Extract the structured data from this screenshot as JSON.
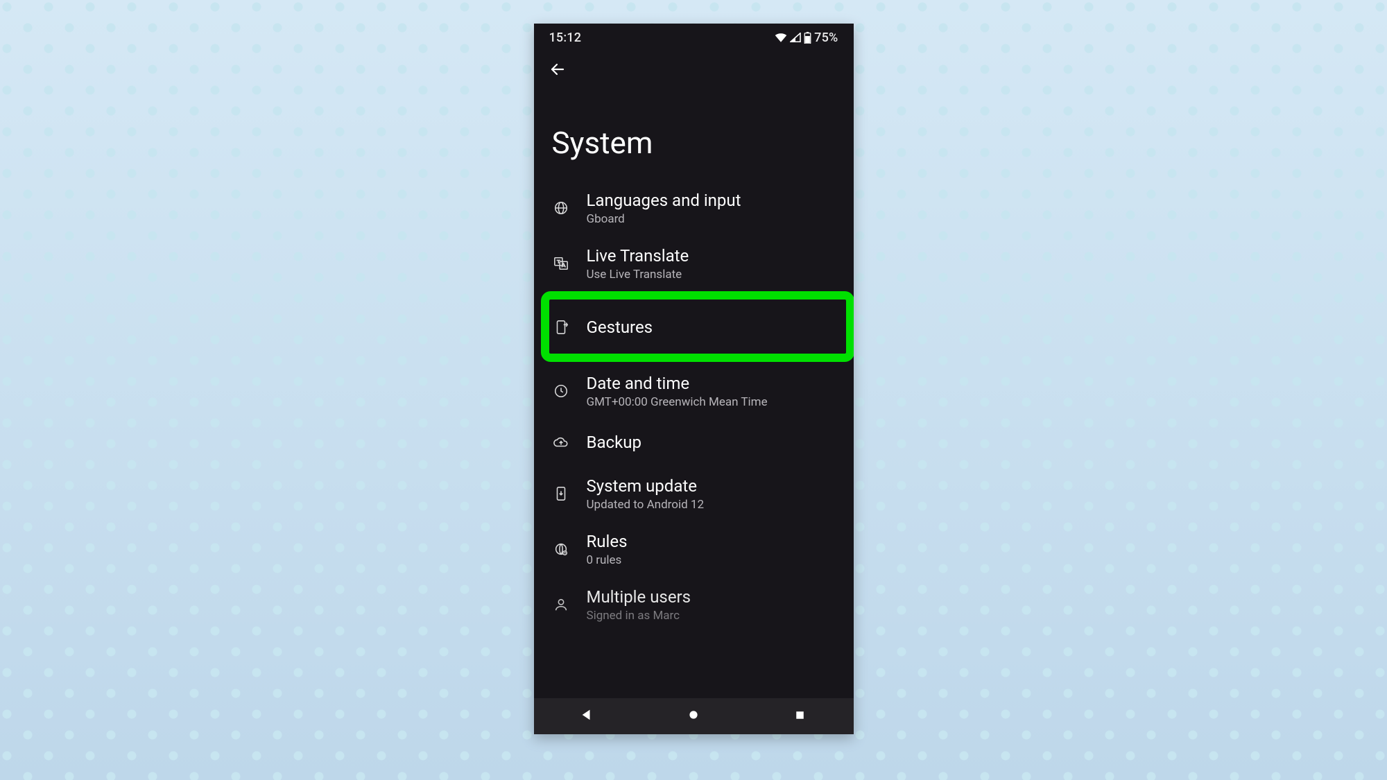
{
  "status": {
    "time": "15:12",
    "battery": "75%"
  },
  "page": {
    "title": "System"
  },
  "rows": {
    "languages": {
      "title": "Languages and input",
      "subtitle": "Gboard"
    },
    "translate": {
      "title": "Live Translate",
      "subtitle": "Use Live Translate"
    },
    "gestures": {
      "title": "Gestures"
    },
    "datetime": {
      "title": "Date and time",
      "subtitle": "GMT+00:00 Greenwich Mean Time"
    },
    "backup": {
      "title": "Backup"
    },
    "update": {
      "title": "System update",
      "subtitle": "Updated to Android 12"
    },
    "rules": {
      "title": "Rules",
      "subtitle": "0 rules"
    },
    "users": {
      "title": "Multiple users",
      "subtitle": "Signed in as Marc"
    }
  },
  "highlighted_row": "gestures",
  "colors": {
    "highlight": "#00e000",
    "phone_bg": "#17151a"
  }
}
